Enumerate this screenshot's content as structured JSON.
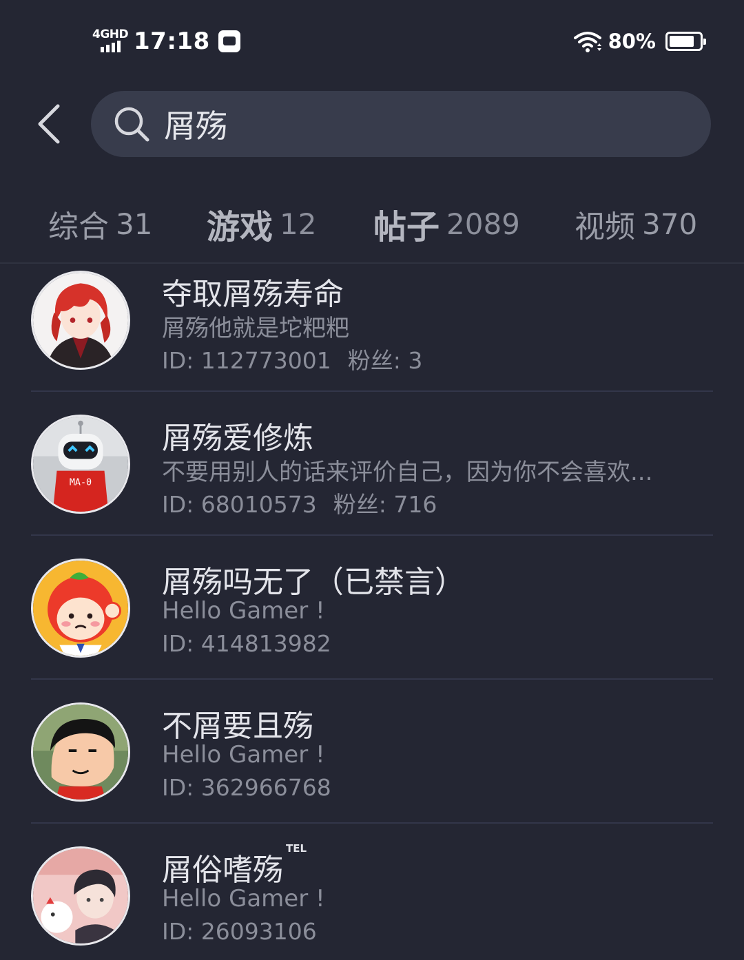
{
  "status_bar": {
    "network": "4GHD",
    "time": "17:18",
    "battery_percent": "80%",
    "battery_level": 0.8
  },
  "search": {
    "query": "屑殇"
  },
  "tabs": [
    {
      "label": "综合",
      "count": "31",
      "active": false
    },
    {
      "label": "游戏",
      "count": "12",
      "active": true
    },
    {
      "label": "帖子",
      "count": "2089",
      "active": true
    },
    {
      "label": "视频",
      "count": "370",
      "active": false
    }
  ],
  "users": [
    {
      "name": "夺取屑殇寿命",
      "bio": "屑殇他就是坨粑粑",
      "id": "ID: 112773001",
      "followers": "粉丝: 3",
      "avatar": "anime-red-hair-avatar"
    },
    {
      "name": "屑殇爱修炼",
      "bio": "不要用别人的话来评价自己，因为你不会喜欢...",
      "id": "ID: 68010573",
      "followers": "粉丝: 716",
      "avatar": "robot-avatar",
      "avatar_text": "MA-0"
    },
    {
      "name": "屑殇吗无了（已禁言）",
      "bio": "Hello Gamer !",
      "id": "ID: 414813982",
      "followers": "",
      "avatar": "tomato-mascot-avatar"
    },
    {
      "name": "不屑要且殇",
      "bio": "Hello Gamer !",
      "id": "ID: 362966768",
      "followers": "",
      "avatar": "cartoon-boy-avatar"
    },
    {
      "name": "屑俗嗜殇",
      "name_badge": "TEL",
      "bio": "Hello Gamer !",
      "id": "ID: 26093106",
      "followers": "",
      "avatar": "anime-boy-avatar"
    }
  ],
  "colors": {
    "background": "#242633",
    "search_box": "#383c4c",
    "primary_text": "#e3e4ea",
    "secondary_text": "#8b8e9a"
  }
}
